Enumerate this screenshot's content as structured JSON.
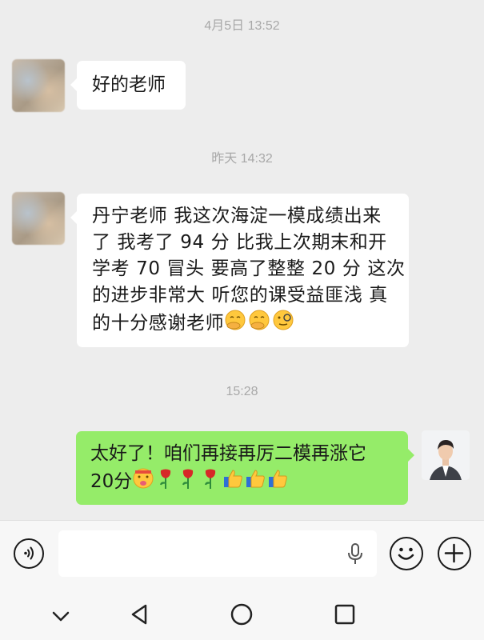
{
  "messages": {
    "ts1": "4月5日 13:52",
    "msg1": "好的老师",
    "ts2": "昨天 14:32",
    "msg2_lines": [
      "丹宁老师 我这次海淀一模成绩出来",
      "了 我考了 94 分 比我上次期末和开",
      "学考 70 冒头 要高了整整 20 分 这次",
      "的进步非常大 听您的课受益匪浅 真",
      "的十分感谢老师"
    ],
    "ts3": "15:28",
    "msg3_lines": [
      "太好了！咱们再接再厉二模再涨它",
      "20分"
    ]
  },
  "icons": {
    "voice": "voice-icon",
    "mic": "microphone-icon",
    "emoji": "emoji-icon",
    "plus": "plus-icon",
    "nav_down": "chevron-down-icon",
    "nav_back": "back-triangle-icon",
    "nav_home": "home-circle-icon",
    "nav_recent": "recent-square-icon",
    "msg2_emojis": [
      "hand-over-mouth-emoji",
      "hand-over-mouth-emoji",
      "monocle-emoji"
    ],
    "msg3_emojis": [
      "tongue-out-emoji",
      "rose-emoji",
      "rose-emoji",
      "rose-emoji",
      "thumbs-up-emoji",
      "thumbs-up-emoji",
      "thumbs-up-emoji"
    ]
  },
  "colors": {
    "background": "#EDEDED",
    "incoming_bubble": "#FFFFFF",
    "outgoing_bubble": "#95EC69",
    "timestamp": "#A8A8A8"
  }
}
